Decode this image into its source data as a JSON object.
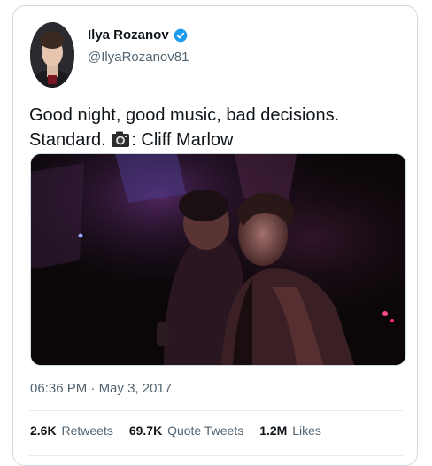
{
  "author": {
    "name": "Ilya Rozanov",
    "handle": "@IlyaRozanov81",
    "verified": true,
    "verified_color": "#1d9bf0"
  },
  "tweet": {
    "text_line1": "Good night, good music, bad decisions.",
    "text_line2_pre": "Standard.",
    "emoji_icon": "camera-icon",
    "text_line2_post": ": Cliff Marlow"
  },
  "timestamp": {
    "time": "06:36 PM",
    "separator": "·",
    "date": "May 3, 2017"
  },
  "stats": {
    "retweets_count": "2.6K",
    "retweets_label": "Retweets",
    "quotes_count": "69.7K",
    "quotes_label": "Quote Tweets",
    "likes_count": "1.2M",
    "likes_label": "Likes"
  }
}
